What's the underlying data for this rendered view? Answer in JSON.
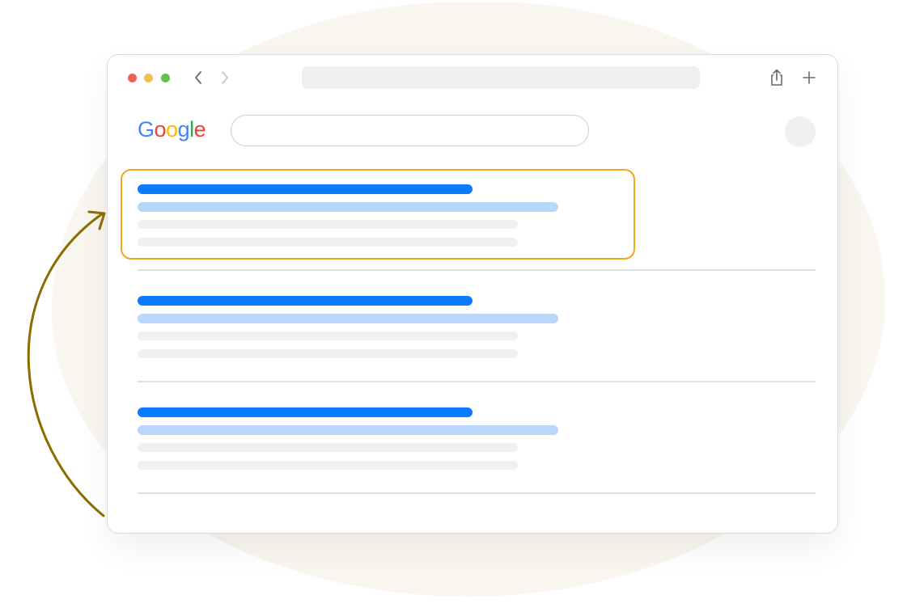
{
  "logo": {
    "letters": [
      "G",
      "o",
      "o",
      "g",
      "l",
      "e"
    ],
    "colors": [
      "#4285f4",
      "#ea4335",
      "#fbbc05",
      "#4285f4",
      "#34a853",
      "#ea4335"
    ]
  },
  "toolbar": {
    "icons": [
      "back-chevron-icon",
      "forward-chevron-icon",
      "share-icon",
      "new-tab-plus-icon"
    ]
  },
  "search": {
    "value": "",
    "placeholder": ""
  },
  "results": {
    "count": 3,
    "highlighted_index": 0
  },
  "colors": {
    "title_bar": "#0b7aff",
    "url_bar": "#b8d7fa",
    "snippet_bar": "#f0f0f0",
    "highlight_border": "#f2a71b",
    "arrow": "#8a6d00",
    "background_blob": "#f8f6ee"
  }
}
